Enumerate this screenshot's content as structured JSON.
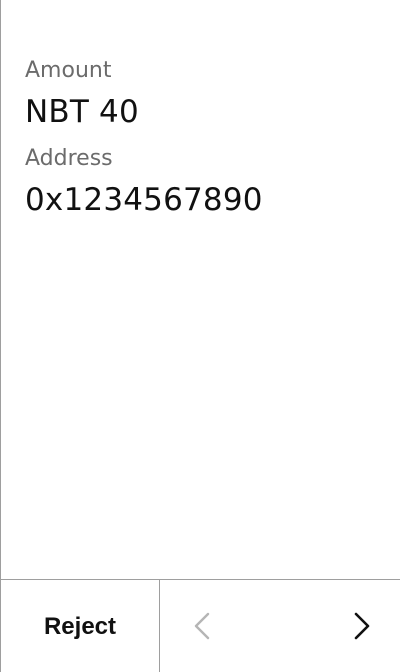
{
  "fields": [
    {
      "label": "Amount",
      "value": "NBT 40"
    },
    {
      "label": "Address",
      "value": "0x1234567890"
    }
  ],
  "footer": {
    "reject_label": "Reject",
    "prev_icon": "chevron-left-icon",
    "next_icon": "chevron-right-icon"
  },
  "colors": {
    "label": "#6b6b6b",
    "value": "#111111",
    "divider": "#9e9e9e",
    "disabled_icon": "#b5b5b5"
  }
}
